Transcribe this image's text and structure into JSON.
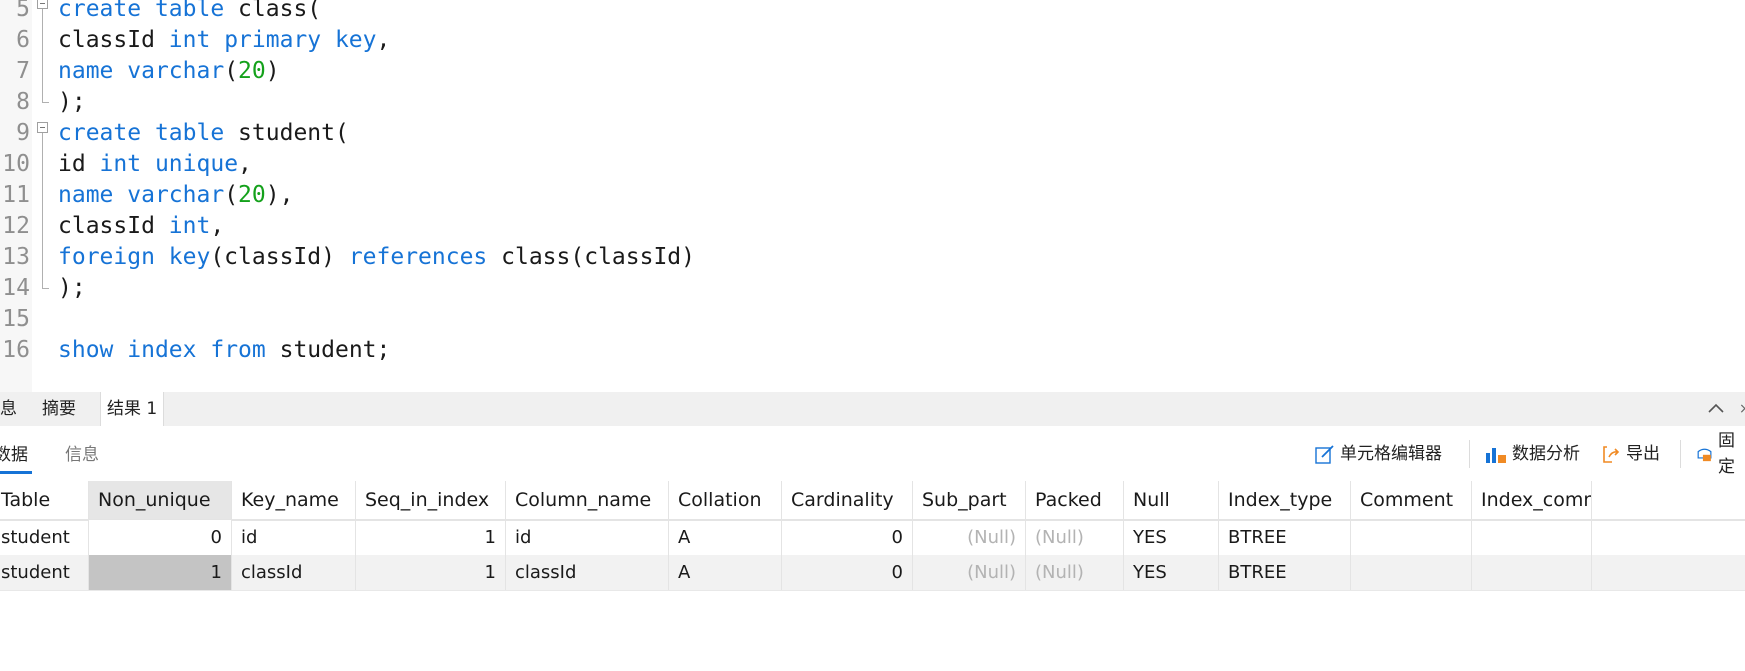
{
  "editor": {
    "lines": [
      {
        "n": "5",
        "fold": "open",
        "tokens": [
          [
            "kw",
            "create"
          ],
          [
            "tx",
            " "
          ],
          [
            "kw",
            "table"
          ],
          [
            "tx",
            " class("
          ]
        ]
      },
      {
        "n": "6",
        "fold": "mid",
        "tokens": [
          [
            "tx",
            "classId "
          ],
          [
            "kw",
            "int"
          ],
          [
            "tx",
            " "
          ],
          [
            "kw",
            "primary key"
          ],
          [
            "tx",
            ","
          ]
        ]
      },
      {
        "n": "7",
        "fold": "mid",
        "tokens": [
          [
            "kw",
            "name"
          ],
          [
            "tx",
            " "
          ],
          [
            "kw",
            "varchar"
          ],
          [
            "tx",
            "("
          ],
          [
            "num",
            "20"
          ],
          [
            "tx",
            ")"
          ]
        ]
      },
      {
        "n": "8",
        "fold": "end",
        "tokens": [
          [
            "tx",
            ");"
          ]
        ]
      },
      {
        "n": "9",
        "fold": "open",
        "tokens": [
          [
            "kw",
            "create"
          ],
          [
            "tx",
            " "
          ],
          [
            "kw",
            "table"
          ],
          [
            "tx",
            " student("
          ]
        ]
      },
      {
        "n": "10",
        "fold": "mid",
        "tokens": [
          [
            "tx",
            "id "
          ],
          [
            "kw",
            "int"
          ],
          [
            "tx",
            " "
          ],
          [
            "kw",
            "unique"
          ],
          [
            "tx",
            ","
          ]
        ]
      },
      {
        "n": "11",
        "fold": "mid",
        "tokens": [
          [
            "kw",
            "name"
          ],
          [
            "tx",
            " "
          ],
          [
            "kw",
            "varchar"
          ],
          [
            "tx",
            "("
          ],
          [
            "num",
            "20"
          ],
          [
            "tx",
            "),"
          ]
        ]
      },
      {
        "n": "12",
        "fold": "mid",
        "tokens": [
          [
            "tx",
            "classId "
          ],
          [
            "kw",
            "int"
          ],
          [
            "tx",
            ","
          ]
        ]
      },
      {
        "n": "13",
        "fold": "mid",
        "tokens": [
          [
            "kw",
            "foreign key"
          ],
          [
            "tx",
            "(classId) "
          ],
          [
            "kw",
            "references"
          ],
          [
            "tx",
            " class(classId)"
          ]
        ]
      },
      {
        "n": "14",
        "fold": "end",
        "tokens": [
          [
            "tx",
            ");"
          ]
        ]
      },
      {
        "n": "15",
        "fold": "",
        "tokens": []
      },
      {
        "n": "16",
        "fold": "",
        "tokens": [
          [
            "kw",
            "show"
          ],
          [
            "tx",
            " "
          ],
          [
            "kw",
            "index"
          ],
          [
            "tx",
            " "
          ],
          [
            "kw",
            "from"
          ],
          [
            "tx",
            " student;"
          ]
        ]
      }
    ]
  },
  "result_tabs": {
    "info_partial": "息",
    "summary": "摘要",
    "result1": "结果 1"
  },
  "subtabs": {
    "data_partial": "数据",
    "info": "信息"
  },
  "toolbar": {
    "cell_editor": "单元格编辑器",
    "data_analysis": "数据分析",
    "export": "导出",
    "pin_partial": "固定"
  },
  "grid": {
    "columns": [
      "Table",
      "Non_unique",
      "Key_name",
      "Seq_in_index",
      "Column_name",
      "Collation",
      "Cardinality",
      "Sub_part",
      "Packed",
      "Null",
      "Index_type",
      "Comment",
      "Index_comment"
    ],
    "rows": [
      [
        "student",
        "0",
        "id",
        "1",
        "id",
        "A",
        "0",
        "(Null)",
        "(Null)",
        "YES",
        "BTREE",
        "",
        ""
      ],
      [
        "student",
        "1",
        "classId",
        "1",
        "classId",
        "A",
        "0",
        "(Null)",
        "(Null)",
        "YES",
        "BTREE",
        "",
        ""
      ]
    ]
  },
  "colors": {
    "keyword": "#1673d6",
    "number": "#14a11b",
    "accent": "#1673d6",
    "null_text": "#b3b3b3"
  }
}
